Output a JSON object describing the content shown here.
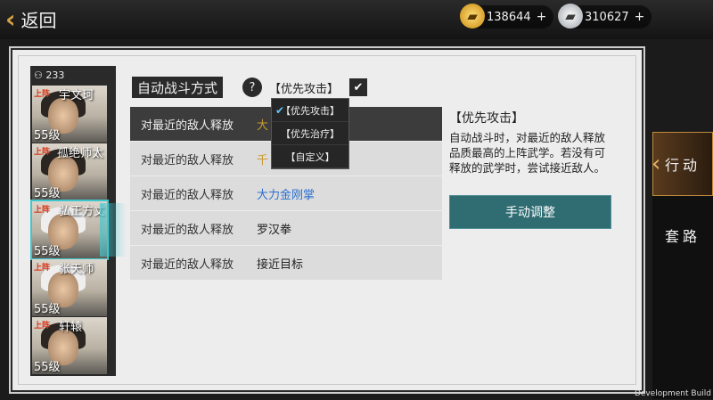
{
  "header": {
    "back_label": "返回",
    "gold_amount": "138644",
    "silver_amount": "310627",
    "plus_symbol": "+"
  },
  "battle": {
    "title": "自动战斗方式",
    "help_symbol": "?",
    "selected_mode": "【优先攻击】"
  },
  "characters": {
    "count": "233",
    "list": [
      {
        "tag": "上阵",
        "name": "宇文珂",
        "level": "55级"
      },
      {
        "tag": "上阵",
        "name": "孤绝师太",
        "level": "55级"
      },
      {
        "tag": "上阵",
        "name": "弘正方丈",
        "level": "55级"
      },
      {
        "tag": "上阵",
        "name": "张天师",
        "level": "55级"
      },
      {
        "tag": "上阵",
        "name": "轩辕",
        "level": "55级"
      }
    ]
  },
  "skill_rows": [
    {
      "label": "对最近的敌人释放",
      "skill": "大"
    },
    {
      "label": "对最近的敌人释放",
      "skill": "千"
    },
    {
      "label": "对最近的敌人释放",
      "skill": "大力金刚掌"
    },
    {
      "label": "对最近的敌人释放",
      "skill": "罗汉拳"
    },
    {
      "label": "对最近的敌人释放",
      "skill": "接近目标"
    }
  ],
  "dropdown": {
    "options": [
      "【优先攻击】",
      "【优先治疗】",
      "【自定义】"
    ],
    "checked_index": 0
  },
  "description": {
    "title": "【优先攻击】",
    "text": "自动战斗时，对最近的敌人释放品质最高的上阵武学。若没有可释放的武学时，尝试接近敌人。",
    "button_label": "手动调整"
  },
  "side_tabs": [
    "行动",
    "套路"
  ],
  "dev_build": "Development Build",
  "colors": {
    "accent_teal": "#2f6d73",
    "selection_cyan": "#3fc6cf",
    "skill_gold": "#c99a2e",
    "skill_blue": "#2b6fd1"
  }
}
